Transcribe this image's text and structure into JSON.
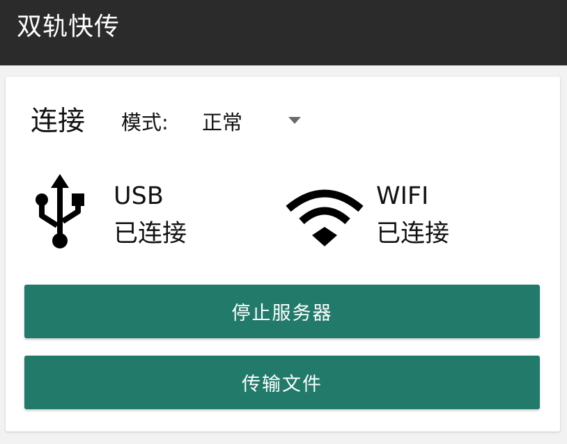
{
  "app_bar": {
    "title": "双轨快传",
    "background": "#2b2b2b"
  },
  "connection": {
    "title": "连接",
    "mode_label": "模式:",
    "mode_value": "正常",
    "usb": {
      "icon": "usb-icon",
      "name": "USB",
      "status": "已连接"
    },
    "wifi": {
      "icon": "wifi-icon",
      "name": "WIFI",
      "status": "已连接"
    }
  },
  "actions": {
    "stop_server_label": "停止服务器",
    "transfer_files_label": "传输文件",
    "button_color": "#227a6b"
  }
}
